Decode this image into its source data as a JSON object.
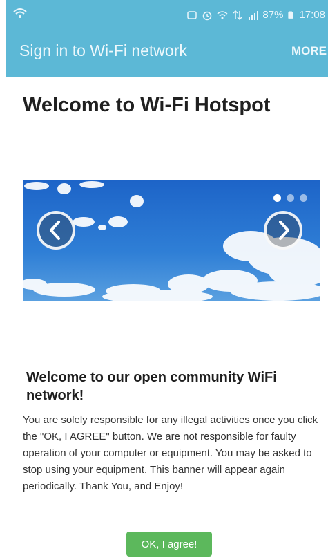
{
  "status_bar": {
    "battery": "87%",
    "time": "17:08"
  },
  "app_bar": {
    "title": "Sign in to Wi-Fi network",
    "more_label": "MORE"
  },
  "page": {
    "title": "Welcome to Wi-Fi Hotspot"
  },
  "carousel": {
    "slide_count": 3,
    "active_index": 0,
    "prev_icon": "chevron-left-icon",
    "next_icon": "chevron-right-icon"
  },
  "content": {
    "heading": "Welcome to our open community WiFi network!",
    "body": "You are solely responsible for any illegal activities once you click the \"OK, I AGREE\" button. We are not responsible for faulty operation of your computer or equipment. You may be asked to stop using your equipment. This banner will appear again periodically. Thank You, and Enjoy!",
    "agree_label": "OK, I agree!"
  },
  "colors": {
    "app_bar": "#5cb8d6",
    "agree_button": "#5cb85c"
  }
}
